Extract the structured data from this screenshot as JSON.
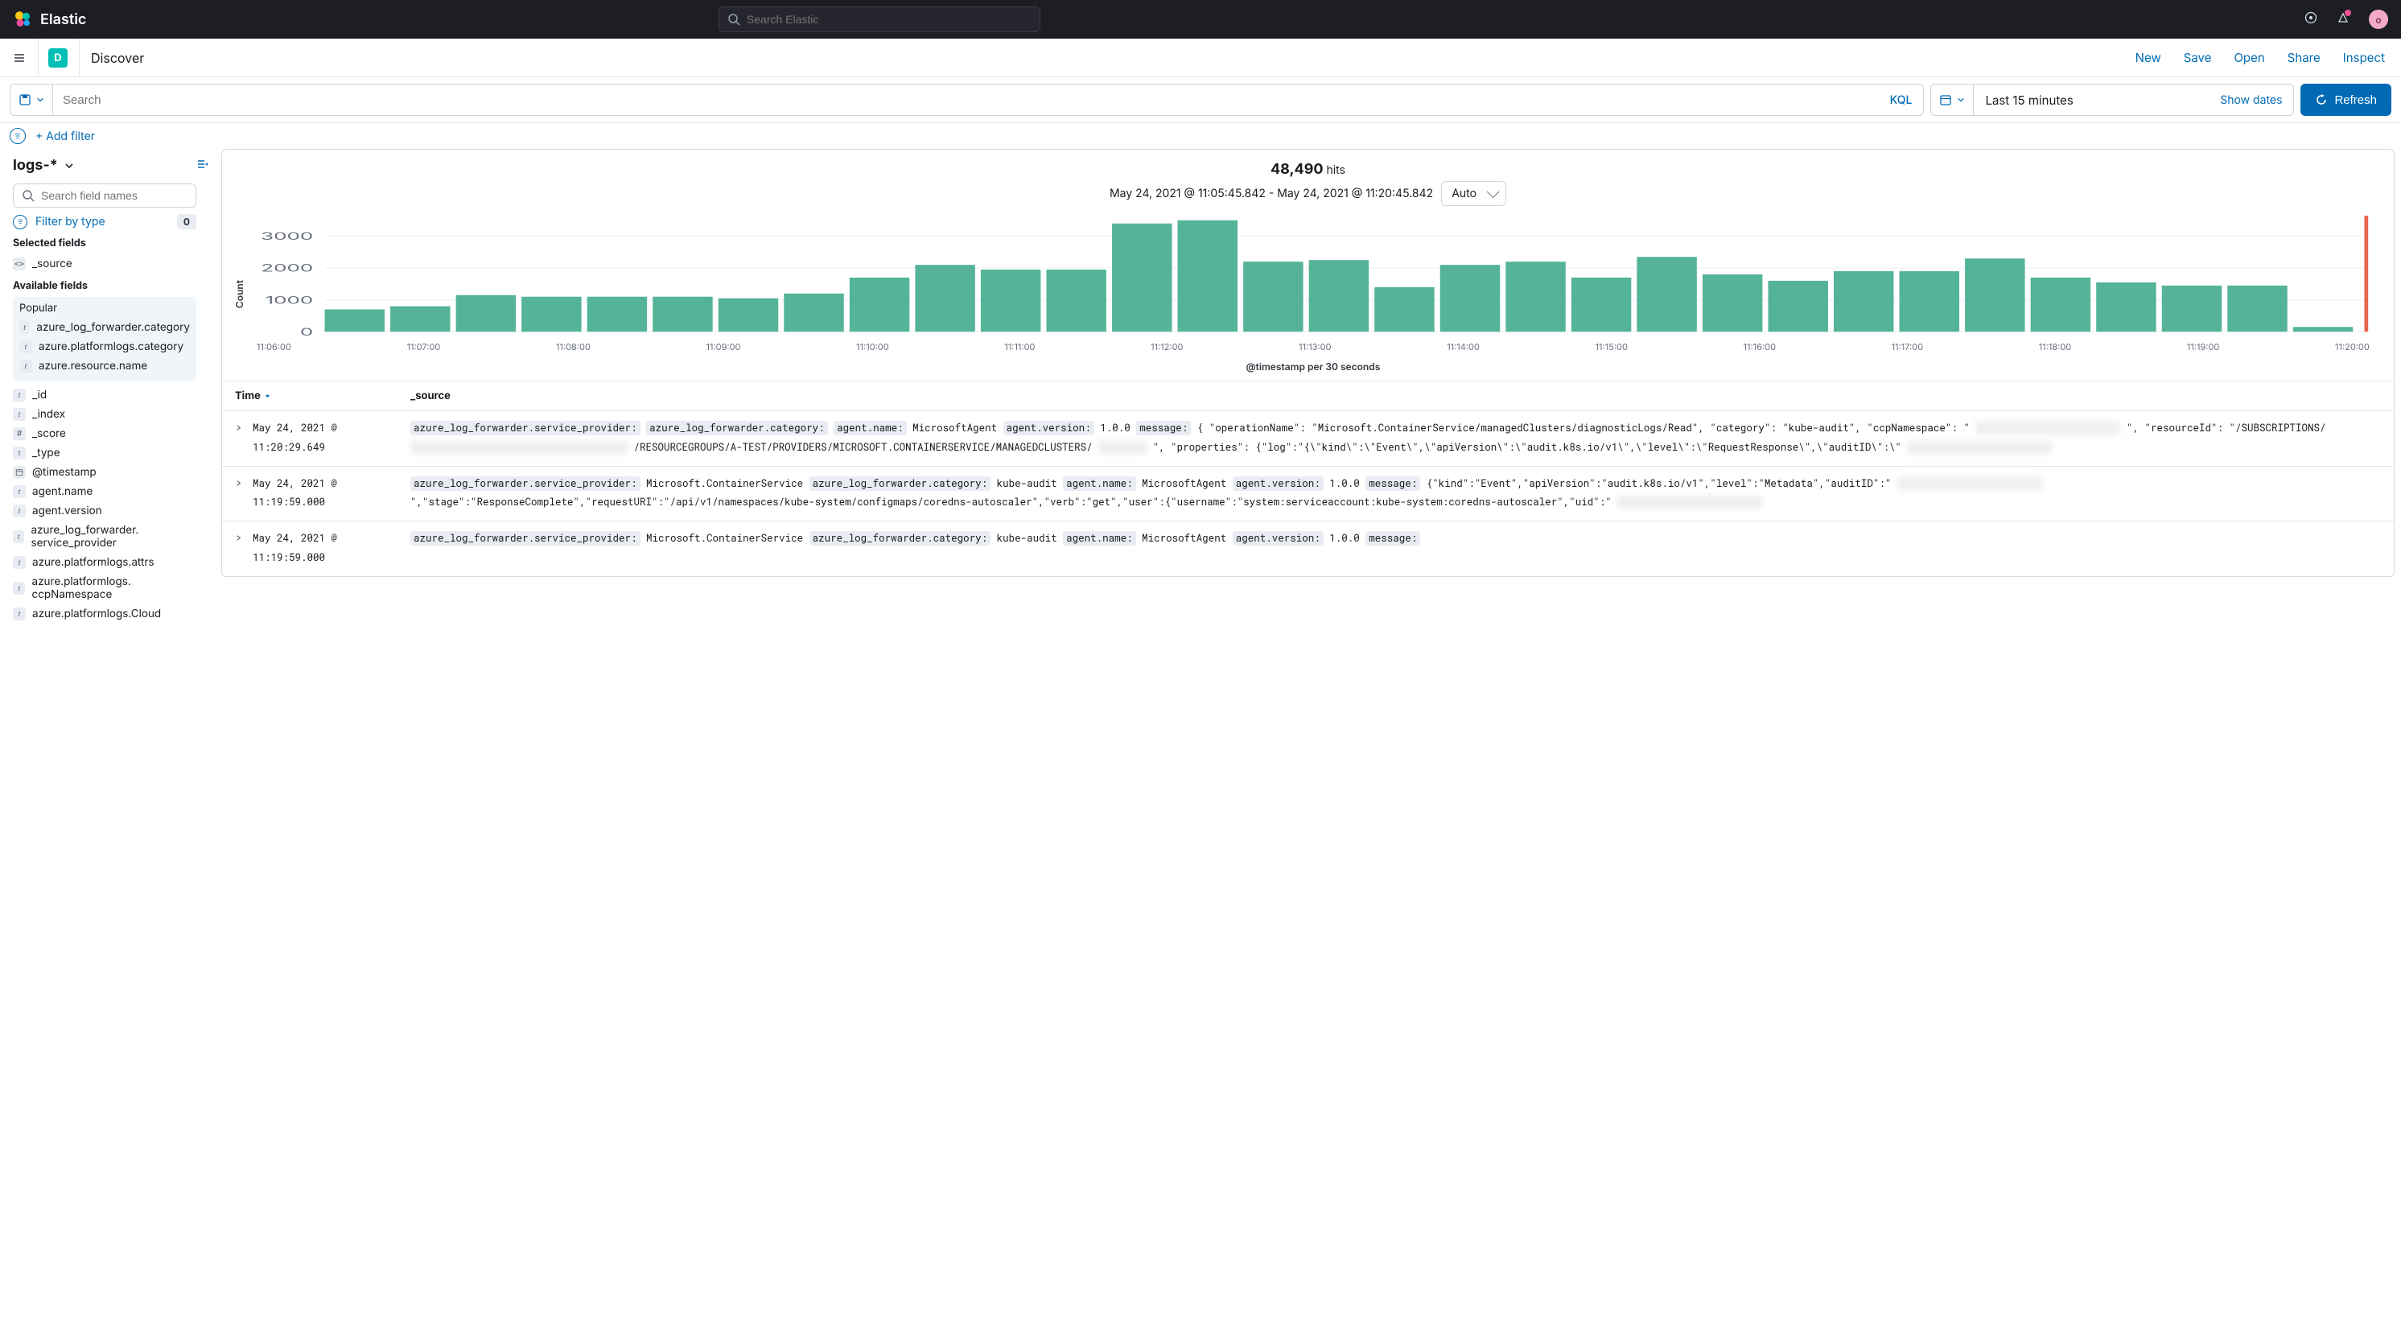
{
  "brand": "Elastic",
  "global_search_placeholder": "Search Elastic",
  "avatar_initial": "o",
  "subheader": {
    "badge": "D",
    "title": "Discover",
    "actions": [
      "New",
      "Save",
      "Open",
      "Share",
      "Inspect"
    ]
  },
  "querybar": {
    "search_placeholder": "Search",
    "lang": "KQL",
    "date_range": "Last 15 minutes",
    "show_dates": "Show dates",
    "refresh": "Refresh"
  },
  "filterbar": {
    "add_filter": "+ Add filter"
  },
  "sidebar": {
    "pattern": "logs-*",
    "field_search_placeholder": "Search field names",
    "filter_by_type": "Filter by type",
    "filter_count": "0",
    "selected_label": "Selected fields",
    "selected_fields": [
      {
        "type": "code",
        "name": "_source"
      }
    ],
    "available_label": "Available fields",
    "popular_label": "Popular",
    "popular_fields": [
      {
        "type": "t",
        "name": "azure_log_forwarder.category"
      },
      {
        "type": "t",
        "name": "azure.platformlogs.category"
      },
      {
        "type": "t",
        "name": "azure.resource.name"
      }
    ],
    "available_fields": [
      {
        "type": "t",
        "name": "_id"
      },
      {
        "type": "t",
        "name": "_index"
      },
      {
        "type": "num",
        "name": "_score"
      },
      {
        "type": "t",
        "name": "_type"
      },
      {
        "type": "date",
        "name": "@timestamp"
      },
      {
        "type": "t",
        "name": "agent.name"
      },
      {
        "type": "t",
        "name": "agent.version"
      },
      {
        "type": "t",
        "name": "azure_log_forwarder. service_provider"
      },
      {
        "type": "t",
        "name": "azure.platformlogs.attrs"
      },
      {
        "type": "t",
        "name": "azure.platformlogs. ccpNamespace"
      },
      {
        "type": "t",
        "name": "azure.platformlogs.Cloud"
      }
    ]
  },
  "hits": {
    "count": "48,490",
    "label": "hits"
  },
  "chart": {
    "date_range_text": "May 24, 2021 @ 11:05:45.842 - May 24, 2021 @ 11:20:45.842",
    "interval": "Auto",
    "ylabel": "Count",
    "xlabel": "@timestamp per 30 seconds",
    "x_ticks": [
      "11:06:00",
      "11:07:00",
      "11:08:00",
      "11:09:00",
      "11:10:00",
      "11:11:00",
      "11:12:00",
      "11:13:00",
      "11:14:00",
      "11:15:00",
      "11:16:00",
      "11:17:00",
      "11:18:00",
      "11:19:00",
      "11:20:00"
    ]
  },
  "chart_data": {
    "type": "bar",
    "title": "48,490 hits",
    "xlabel": "@timestamp per 30 seconds",
    "ylabel": "Count",
    "ylim": [
      0,
      3500
    ],
    "y_ticks": [
      0,
      1000,
      2000,
      3000
    ],
    "categories": [
      "11:05:30",
      "11:06:00",
      "11:06:30",
      "11:07:00",
      "11:07:30",
      "11:08:00",
      "11:08:30",
      "11:09:00",
      "11:09:30",
      "11:10:00",
      "11:10:30",
      "11:11:00",
      "11:11:30",
      "11:12:00",
      "11:12:30",
      "11:13:00",
      "11:13:30",
      "11:14:00",
      "11:14:30",
      "11:15:00",
      "11:15:30",
      "11:16:00",
      "11:16:30",
      "11:17:00",
      "11:17:30",
      "11:18:00",
      "11:18:30",
      "11:19:00",
      "11:19:30",
      "11:20:00",
      "11:20:30"
    ],
    "values": [
      700,
      800,
      1150,
      1100,
      1100,
      1100,
      1050,
      1200,
      1700,
      2100,
      1950,
      1950,
      3400,
      3500,
      2200,
      2250,
      1400,
      2100,
      2200,
      1700,
      2350,
      1800,
      1600,
      1900,
      1900,
      2300,
      1700,
      1550,
      1450,
      1450,
      150
    ]
  },
  "table": {
    "cols": {
      "time": "Time",
      "source": "_source"
    },
    "rows": [
      {
        "time": "May 24, 2021 @ 11:20:29.649",
        "segments": [
          {
            "k": "azure_log_forwarder.service_provider:",
            "v": ""
          },
          {
            "k": "azure_log_forwarder.category:",
            "v": ""
          },
          {
            "k": "agent.name:",
            "v": "MicrosoftAgent"
          },
          {
            "k": "agent.version:",
            "v": "1.0.0"
          },
          {
            "k": "message:",
            "v": "{ \"operationName\": \"Microsoft.ContainerService/managedClusters/diagnosticLogs/Read\", \"category\": \"kube-audit\", \"ccpNamespace\": \""
          },
          {
            "blur": "xxxxxxxxxxxxxxxxxxxxxxxx"
          },
          {
            "v": "\", \"resourceId\": \"/SUBSCRIPTIONS/"
          },
          {
            "blur": "xxxxxxxxxxxxxxxxxxxxxxxxxxxxxxxxxxxx"
          },
          {
            "v": "/RESOURCEGROUPS/A-TEST/PROVIDERS/MICROSOFT.CONTAINERSERVICE/MANAGEDCLUSTERS/"
          },
          {
            "blur": "xxxxxxxx"
          },
          {
            "v": "\", \"properties\": {\"log\":\"{\\\"kind\\\":\\\"Event\\\",\\\"apiVersion\\\":\\\"audit.k8s.io/v1\\\",\\\"level\\\":\\\"RequestResponse\\\",\\\"auditID\\\":\\\""
          },
          {
            "blur": "xxxxxxxxxxxxxxxxxxxxxxxx"
          }
        ]
      },
      {
        "time": "May 24, 2021 @ 11:19:59.000",
        "segments": [
          {
            "k": "azure_log_forwarder.service_provider:",
            "v": "Microsoft.ContainerService"
          },
          {
            "k": "azure_log_forwarder.category:",
            "v": "kube-audit"
          },
          {
            "k": "agent.name:",
            "v": "MicrosoftAgent"
          },
          {
            "k": "agent.version:",
            "v": "1.0.0"
          },
          {
            "k": "message:",
            "v": "{\"kind\":\"Event\",\"apiVersion\":\"audit.k8s.io/v1\",\"level\":\"Metadata\",\"auditID\":\""
          },
          {
            "blur": "xxxxxxxxxxxxxxxxxxxxxxxx"
          },
          {
            "v": "\",\"stage\":\"ResponseComplete\",\"requestURI\":\"/api/v1/namespaces/kube-system/configmaps/coredns-autoscaler\",\"verb\":\"get\",\"user\":{\"username\":\"system:serviceaccount:kube-system:coredns-autoscaler\",\"uid\":\""
          },
          {
            "blur": "xxxxxxxxxxxxxxxxxxxxxxxx"
          }
        ]
      },
      {
        "time": "May 24, 2021 @ 11:19:59.000",
        "segments": [
          {
            "k": "azure_log_forwarder.service_provider:",
            "v": "Microsoft.ContainerService"
          },
          {
            "k": "azure_log_forwarder.category:",
            "v": "kube-audit"
          },
          {
            "k": "agent.name:",
            "v": "MicrosoftAgent"
          },
          {
            "k": "agent.version:",
            "v": "1.0.0"
          },
          {
            "k": "message:",
            "v": ""
          }
        ]
      }
    ]
  }
}
